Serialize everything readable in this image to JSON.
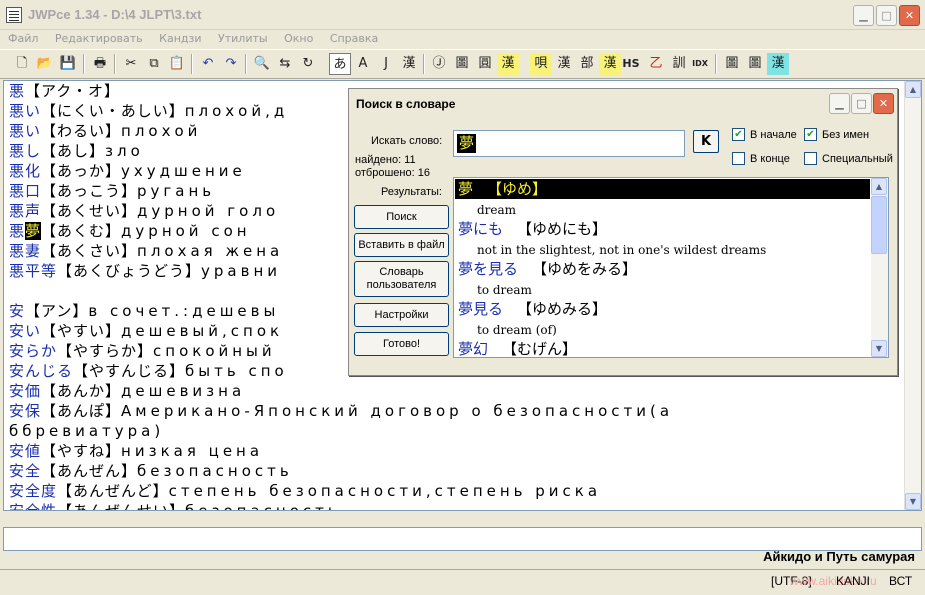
{
  "window": {
    "title": "JWPce 1.34 - D:\\4 JLPT\\3.txt"
  },
  "menu": [
    "Файл",
    "Редактировать",
    "Кандзи",
    "Утилиты",
    "Окно",
    "Справка"
  ],
  "toolbar": {
    "icons": [
      "new-file-icon",
      "open-folder-icon",
      "save-icon",
      "print-icon",
      "cut-icon",
      "copy-icon",
      "paste-icon",
      "undo-icon",
      "redo-icon",
      "find-icon",
      "replace-icon",
      "find-next-icon"
    ],
    "mode_buttons": [
      "あ",
      "A",
      "J",
      "漢"
    ],
    "dict_buttons": [
      "Ⓙ",
      "圖",
      "圓",
      "漢",
      "唄",
      "漢",
      "部",
      "漢",
      "HS",
      "乙",
      "訓",
      "IDX",
      "圖",
      "圖",
      "漢"
    ]
  },
  "editor": {
    "lines": [
      {
        "kanji": "悪",
        "reading": "【アク・オ】",
        "meaning": ""
      },
      {
        "kanji": "悪い",
        "reading": "【にくい・あしい】",
        "meaning": "плохой,д"
      },
      {
        "kanji": "悪い",
        "reading": "【わるい】",
        "meaning": "плохой"
      },
      {
        "kanji": "悪し",
        "reading": "【あし】",
        "meaning": "зло"
      },
      {
        "kanji": "悪化",
        "reading": "【あっか】",
        "meaning": "ухудшение"
      },
      {
        "kanji": "悪口",
        "reading": "【あっこう】",
        "meaning": "ругань"
      },
      {
        "kanji": "悪声",
        "reading": "【あくせい】",
        "meaning": "дурной голо"
      },
      {
        "kanji": "悪",
        "hl": "夢",
        "reading": "【あくむ】",
        "meaning": "дурной сон"
      },
      {
        "kanji": "悪妻",
        "reading": "【あくさい】",
        "meaning": "плохая жена"
      },
      {
        "kanji": "悪平等",
        "reading": "【あくびょうどう】",
        "meaning": "уравни"
      },
      {
        "kanji": "",
        "reading": "",
        "meaning": ""
      },
      {
        "kanji": "安",
        "reading": "【アン】",
        "meaning": "в сочет.:дешевы"
      },
      {
        "kanji": "安い",
        "reading": "【やすい】",
        "meaning": "дешевый,спок"
      },
      {
        "kanji": "安らか",
        "reading": "【やすらか】",
        "meaning": "спокойный"
      },
      {
        "kanji": "安んじる",
        "reading": "【やすんじる】",
        "meaning": "быть спо"
      },
      {
        "kanji": "安価",
        "reading": "【あんか】",
        "meaning": "дешевизна"
      },
      {
        "kanji": "安保",
        "reading": "【あんぽ】",
        "meaning": "Американо-Японский договор о безопасности(а"
      },
      {
        "kanji": "",
        "reading": "",
        "meaning": "ббревиатура)"
      },
      {
        "kanji": "安値",
        "reading": "【やすね】",
        "meaning": "низкая цена"
      },
      {
        "kanji": "安全",
        "reading": "【あんぜん】",
        "meaning": "безопасность"
      },
      {
        "kanji": "安全度",
        "reading": "【あんぜんど】",
        "meaning": "степень безопасности,степень риска"
      },
      {
        "kanji": "安全性",
        "reading": "【あんぜんせい】",
        "meaning": "безопасность"
      }
    ]
  },
  "banner": "Айкидо и Путь самурая",
  "status": {
    "encoding": "[UTF-8]",
    "kanji": "KANJI",
    "ins": "ВСТ",
    "url": "www.aikidoka.ru"
  },
  "dialog": {
    "title": "Поиск в словаре",
    "search_label": "Искать слово:",
    "search_value": "夢",
    "k_button": "K",
    "found": "найдено: 11",
    "rejected": "отброшено: 16",
    "results_label": "Результаты:",
    "checkboxes": [
      {
        "label": "В начале",
        "checked": true
      },
      {
        "label": "Без имен",
        "checked": true
      },
      {
        "label": "В конце",
        "checked": false
      },
      {
        "label": "Специальный",
        "checked": false
      }
    ],
    "buttons": {
      "search": "Поиск",
      "insert": "Вставить в файл",
      "user_dict_1": "Словарь",
      "user_dict_2": "пользователя",
      "settings": "Настройки",
      "done": "Готово!"
    },
    "results": [
      {
        "word": "夢",
        "reading": "【ゆめ】",
        "gloss": "dream",
        "selected": true
      },
      {
        "word": "夢にも",
        "reading": "【ゆめにも】",
        "gloss": "not in the slightest, not in one's wildest dreams"
      },
      {
        "word": "夢を見る",
        "reading": "【ゆめをみる】",
        "gloss": "to dream"
      },
      {
        "word": "夢見る",
        "reading": "【ゆめみる】",
        "gloss": "to dream (of)"
      },
      {
        "word": "夢幻",
        "reading": "【むげん】",
        "gloss": ""
      }
    ]
  }
}
